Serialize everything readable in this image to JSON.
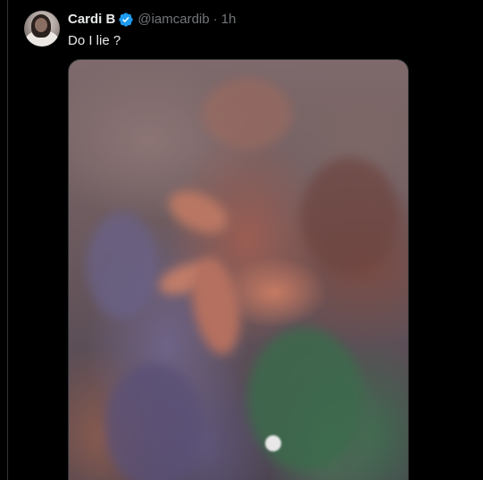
{
  "tweet": {
    "author_name": "Cardi B",
    "handle": "@iamcardib",
    "separator": "·",
    "time": "1h",
    "text": "Do I lie ?",
    "verified": true,
    "verified_color": "#1d9bf0"
  },
  "icons": {
    "verified": "verified-badge-icon"
  },
  "media": {
    "kind": "photo"
  }
}
